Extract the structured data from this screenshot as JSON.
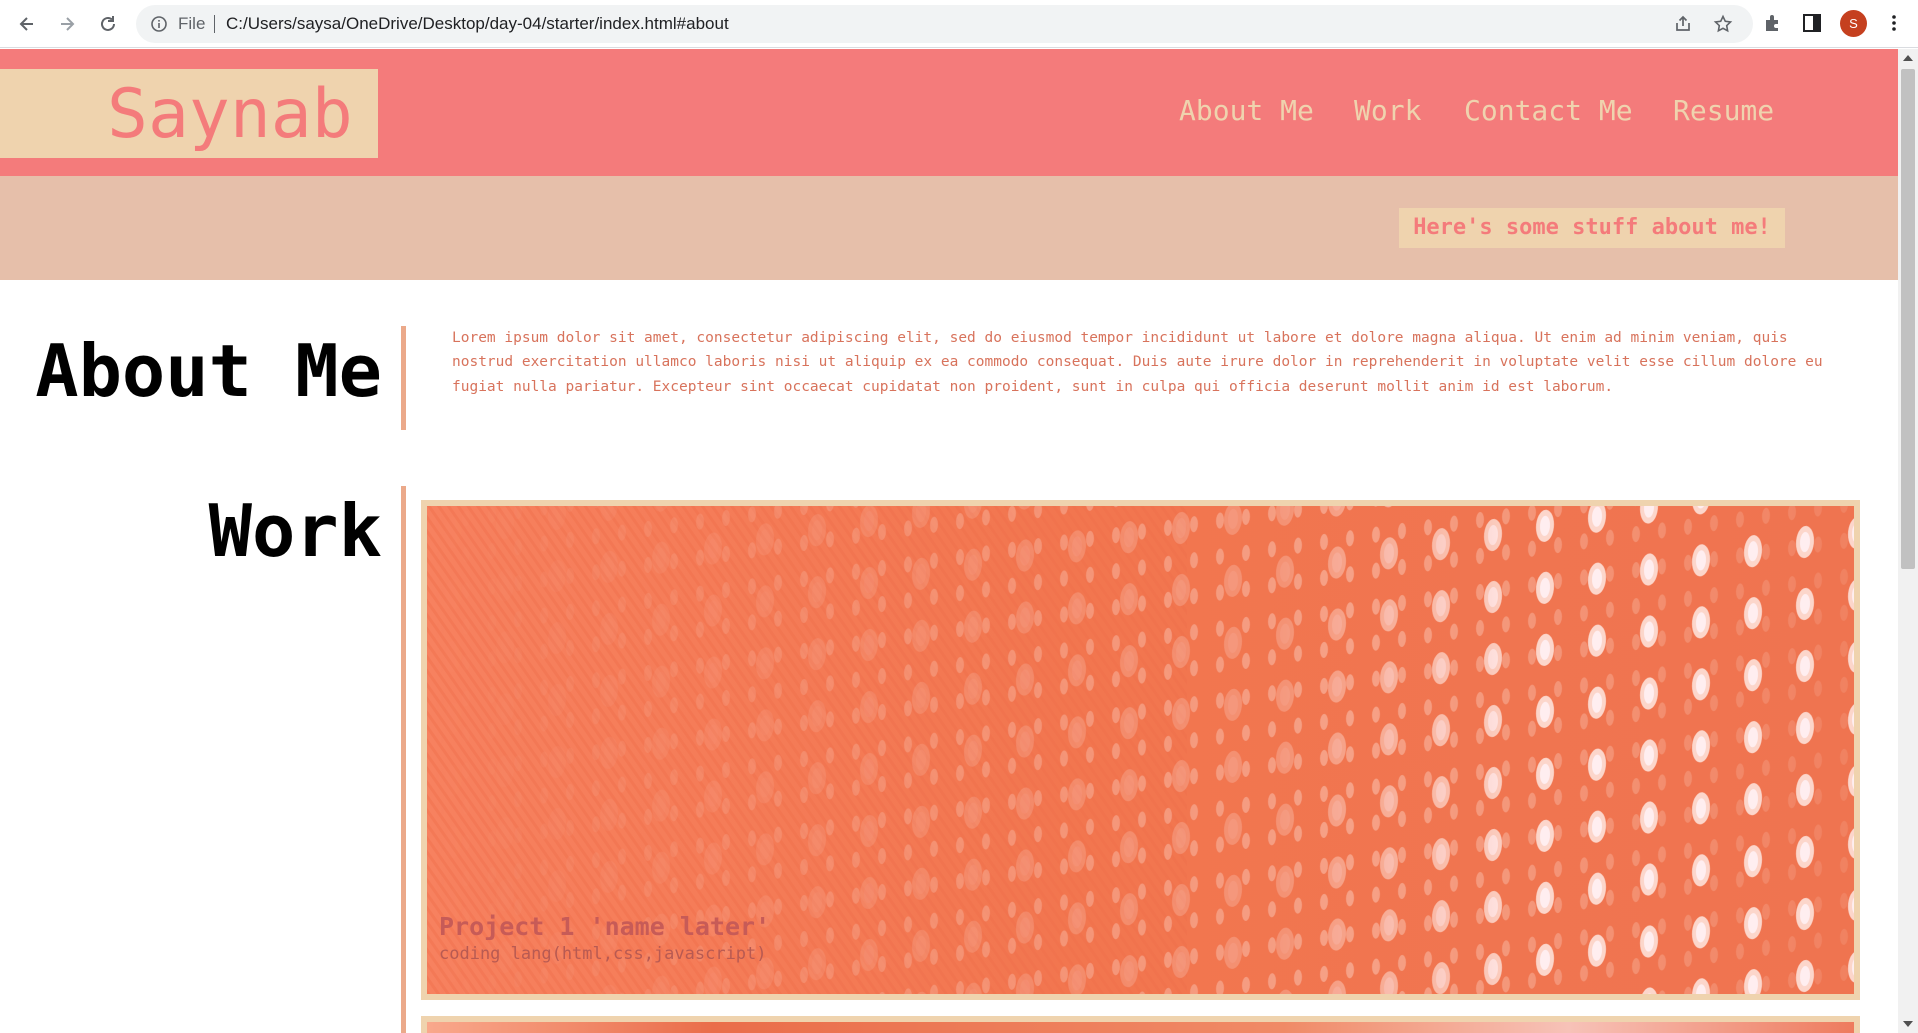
{
  "browser": {
    "file_label": "File",
    "url": "C:/Users/saysa/OneDrive/Desktop/day-04/starter/index.html#about",
    "profile_initial": "S"
  },
  "site": {
    "logo": "Saynab",
    "nav": [
      "About Me",
      "Work",
      "Contact Me",
      "Resume"
    ],
    "hero_tagline": "Here's some stuff about me!"
  },
  "about": {
    "title": "About Me",
    "body": "Lorem ipsum dolor sit amet, consectetur adipiscing elit, sed do eiusmod tempor incididunt ut labore et dolore magna aliqua. Ut enim ad minim veniam, quis nostrud exercitation ullamco laboris nisi ut aliquip ex ea commodo consequat. Duis aute irure dolor in reprehenderit in voluptate velit esse cillum dolore eu fugiat nulla pariatur. Excepteur sint occaecat cupidatat non proident, sunt in culpa qui officia deserunt mollit anim id est laborum."
  },
  "work": {
    "title": "Work",
    "projects": [
      {
        "title": "Project 1 'name later'",
        "subtitle": "coding lang(html,css,javascript)"
      }
    ]
  },
  "colors": {
    "header": "#f47b7b",
    "cream": "#efd3ae",
    "hero": "#e6bfaa",
    "accent_rule": "#eba98a",
    "body_text": "#d8735c"
  }
}
